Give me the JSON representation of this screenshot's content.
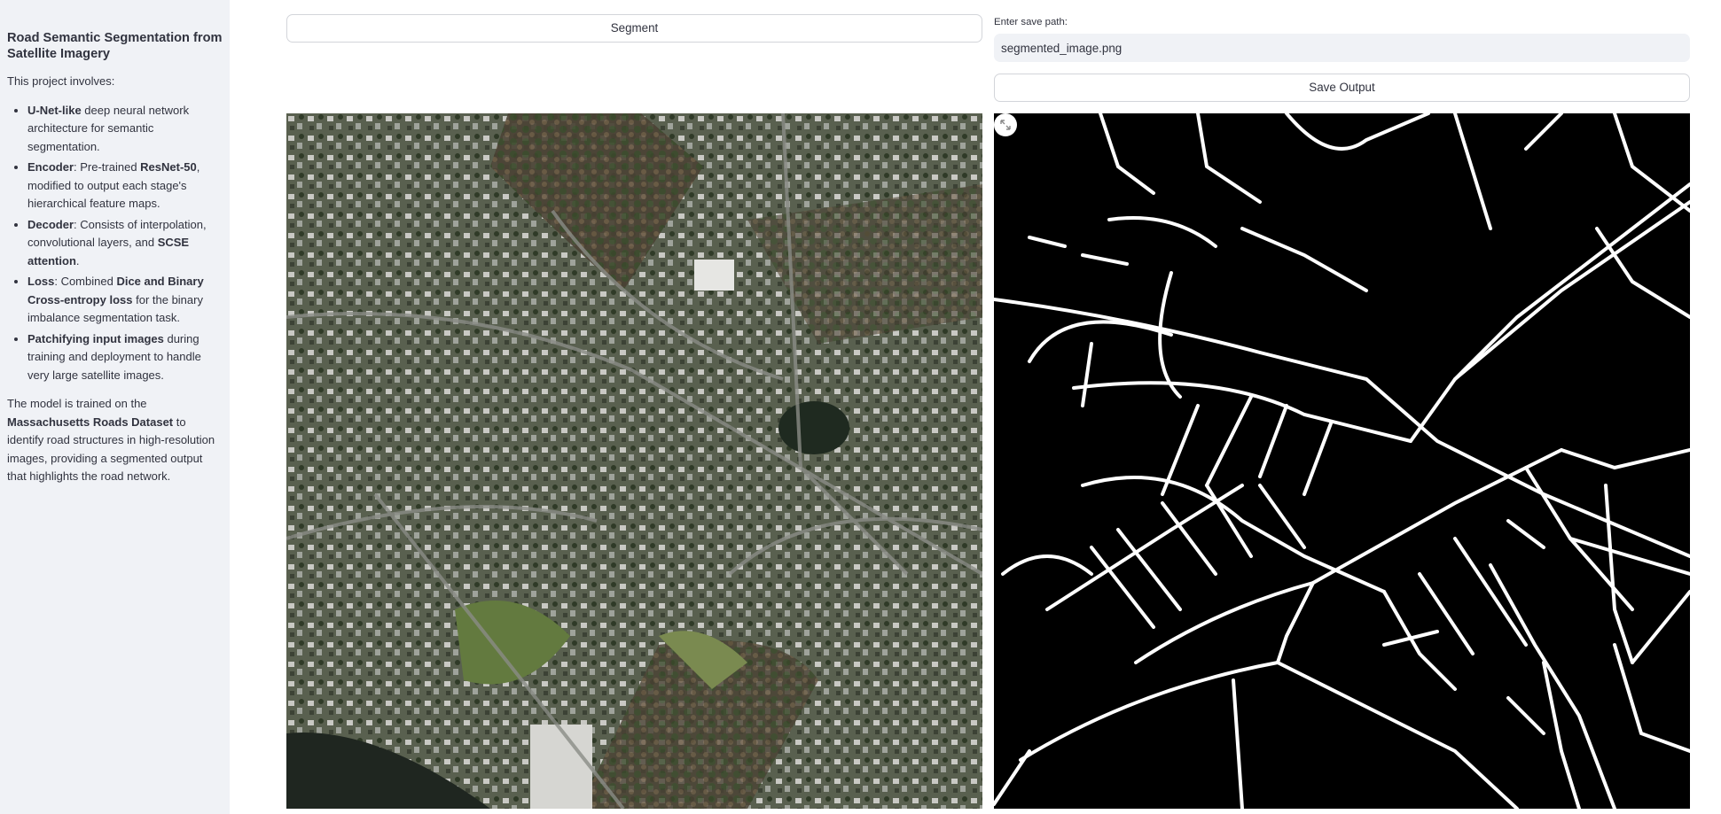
{
  "sidebar": {
    "title": "Road Semantic Segmentation from Satellite Imagery",
    "intro": "This project involves:",
    "items": [
      {
        "bold": "U-Net-like",
        "text": " deep neural network architecture for semantic segmentation."
      },
      {
        "bold": "Encoder",
        "text": ": Pre-trained ",
        "bold2": "ResNet-50",
        "text2": ", modified to output each stage's hierarchical feature maps."
      },
      {
        "bold": "Decoder",
        "text": ": Consists of interpolation, convolutional layers, and ",
        "bold2": "SCSE attention",
        "text2": "."
      },
      {
        "bold": "Loss",
        "text": ": Combined ",
        "bold2": "Dice and Binary Cross-entropy loss",
        "text2": " for the binary imbalance segmentation task."
      },
      {
        "bold": "Patchifying input images",
        "text": " during training and deployment to handle very large satellite images."
      }
    ],
    "outro_1": "The model is trained on the ",
    "outro_bold": "Massachusetts Roads Dataset",
    "outro_2": " to identify road structures in high-resolution images, providing a segmented output that highlights the road network."
  },
  "main": {
    "segment_label": "Segment",
    "save_path_label": "Enter save path:",
    "save_path_value": "segmented_image.png",
    "save_output_label": "Save Output",
    "expand_icon": "expand-icon"
  }
}
